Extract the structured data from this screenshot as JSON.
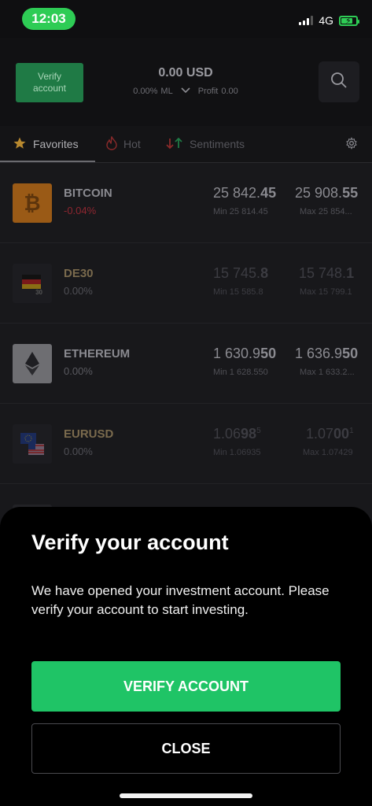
{
  "status_bar": {
    "time": "12:03",
    "network": "4G"
  },
  "header": {
    "verify_label": "Verify account",
    "balance": "0.00 USD",
    "ml_value": "0.00%",
    "ml_label": "ML",
    "profit_label": "Profit",
    "profit_value": "0.00"
  },
  "tabs": [
    {
      "label": "Favorites",
      "icon": "star-icon"
    },
    {
      "label": "Hot",
      "icon": "fire-icon"
    },
    {
      "label": "Sentiments",
      "icon": "up-down-arrows-icon"
    }
  ],
  "assets": [
    {
      "name": "BITCOIN",
      "change": "-0.04%",
      "sell_main": "25 842.",
      "sell_bold": "45",
      "sell_sup": "",
      "sell_min": "Min 25 814.45",
      "buy_main": "25 908.",
      "buy_bold": "55",
      "buy_sup": "",
      "buy_max": "Max 25 854..."
    },
    {
      "name": "DE30",
      "change": "0.00%",
      "sell_main": "15 745.",
      "sell_bold": "8",
      "sell_sup": "",
      "sell_min": "Min 15 585.8",
      "buy_main": "15 748.",
      "buy_bold": "1",
      "buy_sup": "",
      "buy_max": "Max 15 799.1"
    },
    {
      "name": "ETHEREUM",
      "change": "0.00%",
      "sell_main": "1 630.9",
      "sell_bold": "50",
      "sell_sup": "",
      "sell_min": "Min 1 628.550",
      "buy_main": "1 636.9",
      "buy_bold": "50",
      "buy_sup": "",
      "buy_max": "Max 1 633.2..."
    },
    {
      "name": "EURUSD",
      "change": "0.00%",
      "sell_main": "1.06",
      "sell_bold": "98",
      "sell_sup": "5",
      "sell_min": "Min 1.06935",
      "buy_main": "1.07",
      "buy_bold": "00",
      "buy_sup": "1",
      "buy_max": "Max 1.07429"
    }
  ],
  "colors": {
    "accent_green": "#1fc466",
    "negative_red": "#e0424f",
    "gold": "#c9a26a"
  },
  "modal": {
    "title": "Verify your account",
    "body": "We have opened your investment account. Please verify your account to start investing.",
    "verify_button": "VERIFY ACCOUNT",
    "close_button": "CLOSE"
  }
}
